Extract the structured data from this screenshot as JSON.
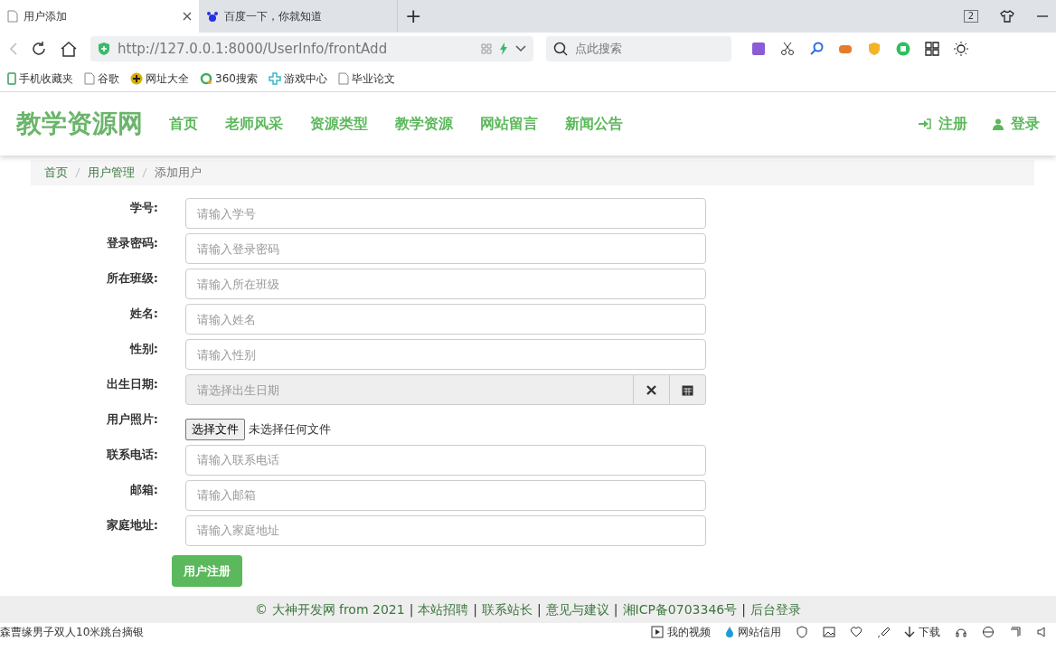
{
  "browser": {
    "tabs": [
      {
        "title": "用户添加",
        "selected": true
      },
      {
        "title": "百度一下，你就知道",
        "selected": false
      }
    ],
    "new_tab": "+",
    "tab_count": "2",
    "address": "http://127.0.0.1:8000/UserInfo/frontAdd",
    "search": {
      "placeholder": "点此搜索"
    },
    "bookmarks": [
      "手机收藏夹",
      "谷歌",
      "网址大全",
      "360搜索",
      "游戏中心",
      "毕业论文"
    ]
  },
  "navbar": {
    "brand": "教学资源网",
    "items": [
      "首页",
      "老师风采",
      "资源类型",
      "教学资源",
      "网站留言",
      "新闻公告"
    ],
    "right": [
      "注册",
      "登录"
    ]
  },
  "breadcrumb": [
    {
      "label": "首页",
      "active": false
    },
    {
      "label": "用户管理",
      "active": false
    },
    {
      "label": "添加用户",
      "active": true
    }
  ],
  "form": {
    "fields": [
      {
        "label": "学号:",
        "kind": "text",
        "placeholder": "请输入学号",
        "disabled": false
      },
      {
        "label": "登录密码:",
        "kind": "text",
        "placeholder": "请输入登录密码",
        "disabled": false
      },
      {
        "label": "所在班级:",
        "kind": "text",
        "placeholder": "请输入所在班级",
        "disabled": false
      },
      {
        "label": "姓名:",
        "kind": "text",
        "placeholder": "请输入姓名",
        "disabled": false
      },
      {
        "label": "性别:",
        "kind": "text",
        "placeholder": "请输入性别",
        "disabled": false
      },
      {
        "label": "出生日期:",
        "kind": "date",
        "placeholder": "请选择出生日期",
        "disabled": true
      },
      {
        "label": "用户照片:",
        "kind": "file",
        "button": "选择文件",
        "status": "未选择任何文件"
      },
      {
        "label": "联系电话:",
        "kind": "text",
        "placeholder": "请输入联系电话",
        "disabled": false
      },
      {
        "label": "邮箱:",
        "kind": "text",
        "placeholder": "请输入邮箱",
        "disabled": false
      },
      {
        "label": "家庭地址:",
        "kind": "text",
        "placeholder": "请输入家庭地址",
        "disabled": false
      }
    ],
    "submit": "用户注册"
  },
  "footer": [
    {
      "kind": "text",
      "text": "© 大神开发网 from 2021"
    },
    {
      "kind": "sep",
      "text": "|"
    },
    {
      "kind": "link",
      "text": "本站招聘"
    },
    {
      "kind": "sep",
      "text": "|"
    },
    {
      "kind": "link",
      "text": "联系站长"
    },
    {
      "kind": "sep",
      "text": "|"
    },
    {
      "kind": "link",
      "text": "意见与建议"
    },
    {
      "kind": "sep",
      "text": "|"
    },
    {
      "kind": "link",
      "text": "湘ICP备0703346号"
    },
    {
      "kind": "sep",
      "text": "|"
    },
    {
      "kind": "link",
      "text": "后台登录"
    }
  ],
  "status_bar": {
    "news": "森曹缘男子双人10米跳台摘银",
    "items": [
      "我的视频",
      "网站信用"
    ],
    "download": "下载"
  }
}
